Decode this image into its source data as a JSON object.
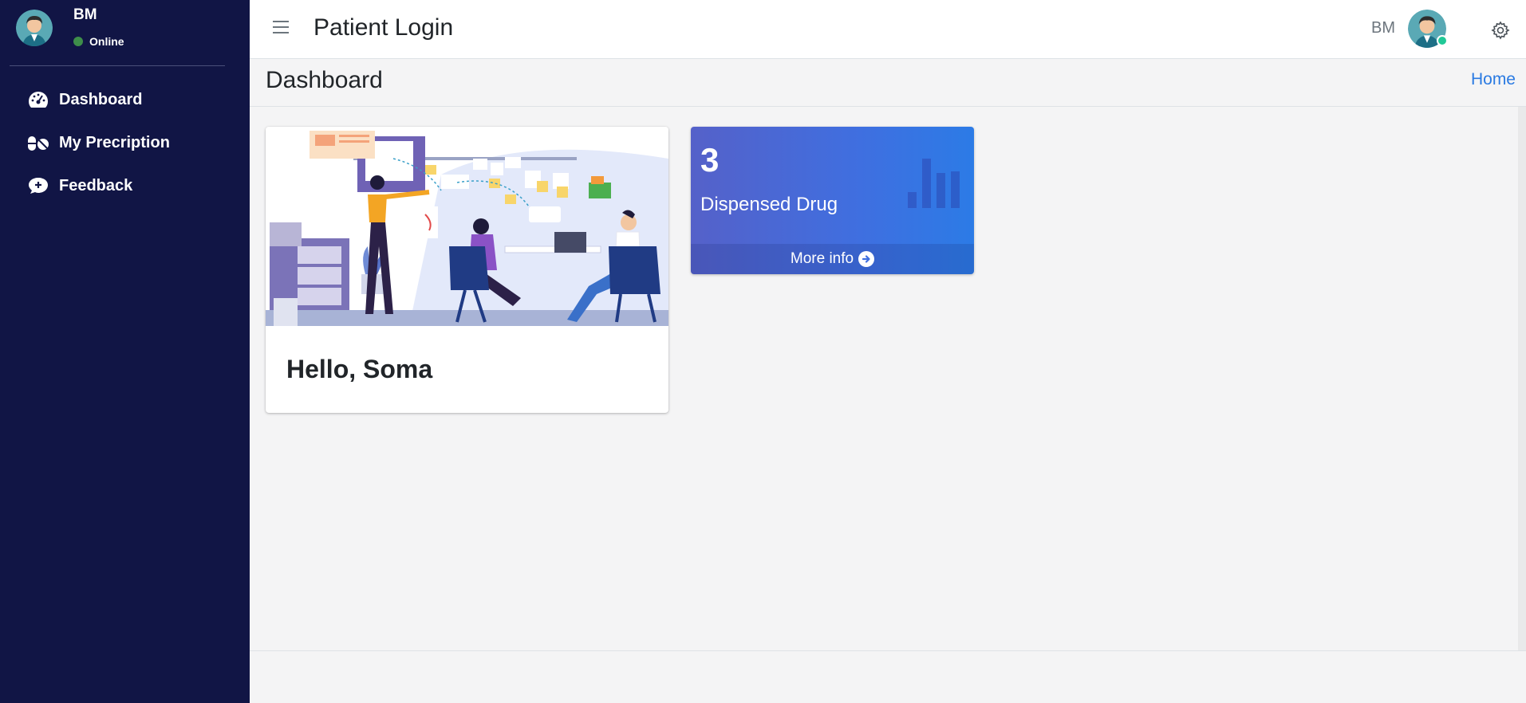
{
  "sidebar": {
    "user": {
      "name": "BM",
      "status": "Online"
    },
    "items": [
      {
        "label": "Dashboard",
        "icon": "tachometer-icon"
      },
      {
        "label": "My Precription",
        "icon": "pills-icon"
      },
      {
        "label": "Feedback",
        "icon": "comment-plus-icon"
      }
    ]
  },
  "header": {
    "title": "Patient Login",
    "user": "BM"
  },
  "content": {
    "title": "Dashboard",
    "breadcrumb": "Home"
  },
  "welcome_card": {
    "greeting": "Hello, Soma"
  },
  "info_box": {
    "count": "3",
    "label": "Dispensed Drug",
    "more_info": "More info"
  },
  "colors": {
    "sidebar_bg": "#111545",
    "accent": "#2a7ae2",
    "online": "#3e8e4a"
  }
}
